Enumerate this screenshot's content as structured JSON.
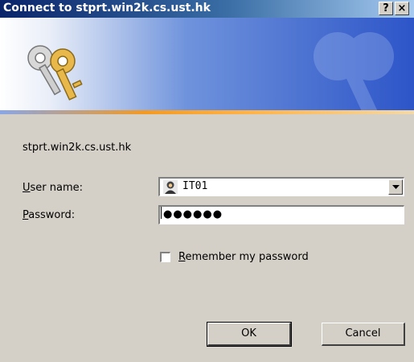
{
  "window": {
    "title": "Connect to stprt.win2k.cs.ust.hk",
    "help_glyph": "?",
    "close_glyph": "×"
  },
  "banner": {
    "icon": "keys-icon",
    "watermark_icon": "keys-watermark-icon",
    "colors": {
      "start": "#ffffff",
      "end": "#2d55c8",
      "stripe": "#f39a23"
    }
  },
  "dialog": {
    "server": "stprt.win2k.cs.ust.hk",
    "username_label_accel": "U",
    "username_label_rest": "ser name:",
    "password_label_accel": "P",
    "password_label_rest": "assword:",
    "username_value": "IT01",
    "username_icon": "user-icon",
    "password_mask": "●●●●●●",
    "remember_accel": "R",
    "remember_rest": "emember my password",
    "remember_checked": false
  },
  "buttons": {
    "ok": "OK",
    "cancel": "Cancel"
  }
}
